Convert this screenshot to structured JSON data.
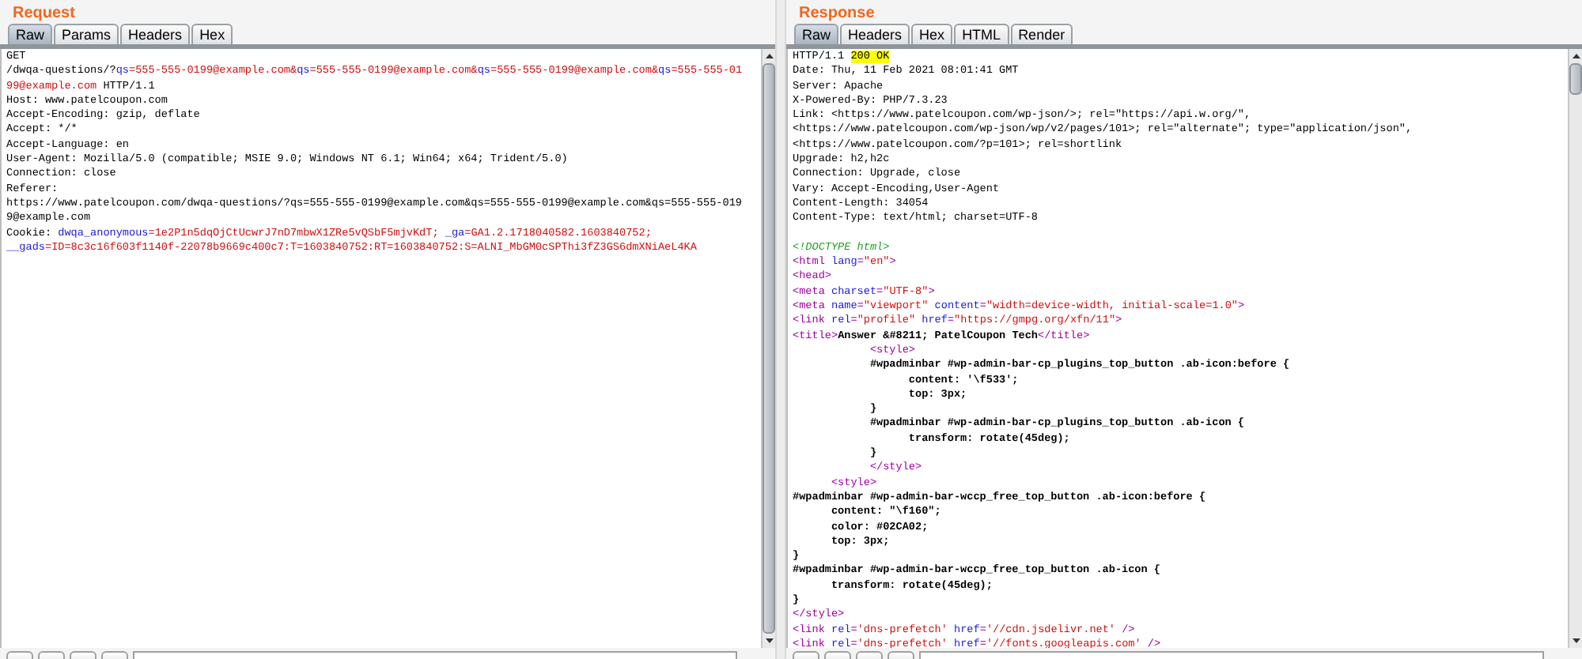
{
  "request": {
    "title": "Request",
    "tabs": [
      {
        "label": "Raw",
        "selected": true
      },
      {
        "label": "Params",
        "selected": false
      },
      {
        "label": "Headers",
        "selected": false
      },
      {
        "label": "Hex",
        "selected": false
      }
    ],
    "lines": [
      {
        "kind": "code",
        "segments": [
          {
            "kind": "plain",
            "text": "GET"
          }
        ]
      },
      {
        "kind": "code",
        "segments": [
          {
            "kind": "plain",
            "text": "/dwqa-questions/?"
          },
          {
            "kind": "key",
            "text": "qs"
          },
          {
            "kind": "value",
            "text": "=555-555-0199@example.com&"
          },
          {
            "kind": "key",
            "text": "qs"
          },
          {
            "kind": "value",
            "text": "=555-555-0199@example.com&"
          },
          {
            "kind": "key",
            "text": "qs"
          },
          {
            "kind": "value",
            "text": "=555-555-0199@example.com&"
          },
          {
            "kind": "key",
            "text": "qs"
          },
          {
            "kind": "value",
            "text": "=555-555-01"
          }
        ]
      },
      {
        "kind": "code",
        "segments": [
          {
            "kind": "value",
            "text": "99@example.com"
          },
          {
            "kind": "plain",
            "text": " HTTP/1.1"
          }
        ]
      },
      {
        "kind": "code",
        "segments": [
          {
            "kind": "plain",
            "text": "Host: www.patelcoupon.com"
          }
        ]
      },
      {
        "kind": "code",
        "segments": [
          {
            "kind": "plain",
            "text": "Accept-Encoding: gzip, deflate"
          }
        ]
      },
      {
        "kind": "code",
        "segments": [
          {
            "kind": "plain",
            "text": "Accept: */*"
          }
        ]
      },
      {
        "kind": "code",
        "segments": [
          {
            "kind": "plain",
            "text": "Accept-Language: en"
          }
        ]
      },
      {
        "kind": "code",
        "segments": [
          {
            "kind": "plain",
            "text": "User-Agent: Mozilla/5.0 (compatible; MSIE 9.0; Windows NT 6.1; Win64; x64; Trident/5.0)"
          }
        ]
      },
      {
        "kind": "code",
        "segments": [
          {
            "kind": "plain",
            "text": "Connection: close"
          }
        ]
      },
      {
        "kind": "code",
        "segments": [
          {
            "kind": "plain",
            "text": "Referer:"
          }
        ]
      },
      {
        "kind": "code",
        "segments": [
          {
            "kind": "plain",
            "text": "https://www.patelcoupon.com/dwqa-questions/?qs=555-555-0199@example.com&qs=555-555-0199@example.com&qs=555-555-019"
          }
        ]
      },
      {
        "kind": "code",
        "segments": [
          {
            "kind": "plain",
            "text": "9@example.com"
          }
        ]
      },
      {
        "kind": "code",
        "segments": [
          {
            "kind": "plain",
            "text": "Cookie: "
          },
          {
            "kind": "key",
            "text": "dwqa_anonymous"
          },
          {
            "kind": "value",
            "text": "=1e2P1n5dqOjCtUcwrJ7nD7mbwX1ZRe5vQSbF5mjvKdT; "
          },
          {
            "kind": "key",
            "text": "_ga"
          },
          {
            "kind": "value",
            "text": "=GA1.2.1718040582.1603840752;"
          }
        ]
      },
      {
        "kind": "code",
        "segments": [
          {
            "kind": "key",
            "text": "__gads"
          },
          {
            "kind": "value",
            "text": "=ID=8c3c16f603f1140f-22078b9669c400c7:T=1603840752:RT=1603840752:S=ALNI_MbGM0cSPThi3fZ3GS6dmXNiAeL4KA"
          }
        ]
      }
    ]
  },
  "response": {
    "title": "Response",
    "tabs": [
      {
        "label": "Raw",
        "selected": true
      },
      {
        "label": "Headers",
        "selected": false
      },
      {
        "label": "Hex",
        "selected": false
      },
      {
        "label": "HTML",
        "selected": false
      },
      {
        "label": "Render",
        "selected": false
      }
    ],
    "lines": [
      {
        "kind": "code",
        "segments": [
          {
            "kind": "plain",
            "text": "HTTP/1.1 "
          },
          {
            "kind": "highlight",
            "text": "200 OK"
          }
        ]
      },
      {
        "kind": "code",
        "segments": [
          {
            "kind": "plain",
            "text": "Date: Thu, 11 Feb 2021 08:01:41 GMT"
          }
        ]
      },
      {
        "kind": "code",
        "segments": [
          {
            "kind": "plain",
            "text": "Server: Apache"
          }
        ]
      },
      {
        "kind": "code",
        "segments": [
          {
            "kind": "plain",
            "text": "X-Powered-By: PHP/7.3.23"
          }
        ]
      },
      {
        "kind": "code",
        "segments": [
          {
            "kind": "plain",
            "text": "Link: <https://www.patelcoupon.com/wp-json/>; rel=\"https://api.w.org/\","
          }
        ]
      },
      {
        "kind": "code",
        "segments": [
          {
            "kind": "plain",
            "text": "<https://www.patelcoupon.com/wp-json/wp/v2/pages/101>; rel=\"alternate\"; type=\"application/json\","
          }
        ]
      },
      {
        "kind": "code",
        "segments": [
          {
            "kind": "plain",
            "text": "<https://www.patelcoupon.com/?p=101>; rel=shortlink"
          }
        ]
      },
      {
        "kind": "code",
        "segments": [
          {
            "kind": "plain",
            "text": "Upgrade: h2,h2c"
          }
        ]
      },
      {
        "kind": "code",
        "segments": [
          {
            "kind": "plain",
            "text": "Connection: Upgrade, close"
          }
        ]
      },
      {
        "kind": "code",
        "segments": [
          {
            "kind": "plain",
            "text": "Vary: Accept-Encoding,User-Agent"
          }
        ]
      },
      {
        "kind": "code",
        "segments": [
          {
            "kind": "plain",
            "text": "Content-Length: 34054"
          }
        ]
      },
      {
        "kind": "code",
        "segments": [
          {
            "kind": "plain",
            "text": "Content-Type: text/html; charset=UTF-8"
          }
        ]
      },
      {
        "kind": "blank"
      },
      {
        "kind": "code",
        "segments": [
          {
            "kind": "comment",
            "text": "<!DOCTYPE html>"
          }
        ]
      },
      {
        "kind": "code",
        "segments": [
          {
            "kind": "tag",
            "text": "<html "
          },
          {
            "kind": "attr",
            "text": "lang"
          },
          {
            "kind": "tag",
            "text": "="
          },
          {
            "kind": "string",
            "text": "\"en\""
          },
          {
            "kind": "tag",
            "text": ">"
          }
        ]
      },
      {
        "kind": "code",
        "segments": [
          {
            "kind": "tag",
            "text": "<head>"
          }
        ]
      },
      {
        "kind": "code",
        "segments": [
          {
            "kind": "tag",
            "text": "<meta "
          },
          {
            "kind": "attr",
            "text": "charset"
          },
          {
            "kind": "tag",
            "text": "="
          },
          {
            "kind": "string",
            "text": "\"UTF-8\""
          },
          {
            "kind": "tag",
            "text": ">"
          }
        ]
      },
      {
        "kind": "code",
        "segments": [
          {
            "kind": "tag",
            "text": "<meta "
          },
          {
            "kind": "attr",
            "text": "name"
          },
          {
            "kind": "tag",
            "text": "="
          },
          {
            "kind": "string",
            "text": "\"viewport\" "
          },
          {
            "kind": "attr",
            "text": "content"
          },
          {
            "kind": "tag",
            "text": "="
          },
          {
            "kind": "string",
            "text": "\"width=device-width, initial-scale=1.0\""
          },
          {
            "kind": "tag",
            "text": ">"
          }
        ]
      },
      {
        "kind": "code",
        "segments": [
          {
            "kind": "tag",
            "text": "<link "
          },
          {
            "kind": "attr",
            "text": "rel"
          },
          {
            "kind": "tag",
            "text": "="
          },
          {
            "kind": "string",
            "text": "\"profile\" "
          },
          {
            "kind": "attr",
            "text": "href"
          },
          {
            "kind": "tag",
            "text": "="
          },
          {
            "kind": "string",
            "text": "\"https://gmpg.org/xfn/11\""
          },
          {
            "kind": "tag",
            "text": ">"
          }
        ]
      },
      {
        "kind": "code",
        "segments": [
          {
            "kind": "tag",
            "text": "<title>"
          },
          {
            "kind": "text",
            "text": "Answer &#8211; PatelCoupon Tech"
          },
          {
            "kind": "tag",
            "text": "</title>"
          }
        ]
      },
      {
        "kind": "code",
        "segments": [
          {
            "kind": "tag",
            "text": "            <style>"
          }
        ]
      },
      {
        "kind": "code",
        "segments": [
          {
            "kind": "text",
            "text": "            #wpadminbar #wp-admin-bar-cp_plugins_top_button .ab-icon:before {"
          }
        ]
      },
      {
        "kind": "code",
        "segments": [
          {
            "kind": "text",
            "text": "                  content: '\\f533';"
          }
        ]
      },
      {
        "kind": "code",
        "segments": [
          {
            "kind": "text",
            "text": "                  top: 3px;"
          }
        ]
      },
      {
        "kind": "code",
        "segments": [
          {
            "kind": "text",
            "text": "            }"
          }
        ]
      },
      {
        "kind": "code",
        "segments": [
          {
            "kind": "text",
            "text": "            #wpadminbar #wp-admin-bar-cp_plugins_top_button .ab-icon {"
          }
        ]
      },
      {
        "kind": "code",
        "segments": [
          {
            "kind": "text",
            "text": "                  transform: rotate(45deg);"
          }
        ]
      },
      {
        "kind": "code",
        "segments": [
          {
            "kind": "text",
            "text": "            }"
          }
        ]
      },
      {
        "kind": "code",
        "segments": [
          {
            "kind": "tag",
            "text": "            </style>"
          }
        ]
      },
      {
        "kind": "code",
        "segments": [
          {
            "kind": "tag",
            "text": "      <style>"
          }
        ]
      },
      {
        "kind": "code",
        "segments": [
          {
            "kind": "text",
            "text": "#wpadminbar #wp-admin-bar-wccp_free_top_button .ab-icon:before {"
          }
        ]
      },
      {
        "kind": "code",
        "segments": [
          {
            "kind": "text",
            "text": "      content: \"\\f160\";"
          }
        ]
      },
      {
        "kind": "code",
        "segments": [
          {
            "kind": "text",
            "text": "      color: #02CA02;"
          }
        ]
      },
      {
        "kind": "code",
        "segments": [
          {
            "kind": "text",
            "text": "      top: 3px;"
          }
        ]
      },
      {
        "kind": "code",
        "segments": [
          {
            "kind": "text",
            "text": "}"
          }
        ]
      },
      {
        "kind": "code",
        "segments": [
          {
            "kind": "text",
            "text": "#wpadminbar #wp-admin-bar-wccp_free_top_button .ab-icon {"
          }
        ]
      },
      {
        "kind": "code",
        "segments": [
          {
            "kind": "text",
            "text": "      transform: rotate(45deg);"
          }
        ]
      },
      {
        "kind": "code",
        "segments": [
          {
            "kind": "text",
            "text": "}"
          }
        ]
      },
      {
        "kind": "code",
        "segments": [
          {
            "kind": "tag",
            "text": "</style>"
          }
        ]
      },
      {
        "kind": "code",
        "segments": [
          {
            "kind": "tag",
            "text": "<link "
          },
          {
            "kind": "attr",
            "text": "rel"
          },
          {
            "kind": "tag",
            "text": "="
          },
          {
            "kind": "string",
            "text": "'dns-prefetch' "
          },
          {
            "kind": "attr",
            "text": "href"
          },
          {
            "kind": "tag",
            "text": "="
          },
          {
            "kind": "string",
            "text": "'//cdn.jsdelivr.net'"
          },
          {
            "kind": "tag",
            "text": " />"
          }
        ]
      },
      {
        "kind": "code",
        "segments": [
          {
            "kind": "tag",
            "text": "<link "
          },
          {
            "kind": "attr",
            "text": "rel"
          },
          {
            "kind": "tag",
            "text": "="
          },
          {
            "kind": "string",
            "text": "'dns-prefetch' "
          },
          {
            "kind": "attr",
            "text": "href"
          },
          {
            "kind": "tag",
            "text": "="
          },
          {
            "kind": "string",
            "text": "'//fonts.googleapis.com'"
          },
          {
            "kind": "tag",
            "text": " />"
          }
        ]
      }
    ]
  }
}
